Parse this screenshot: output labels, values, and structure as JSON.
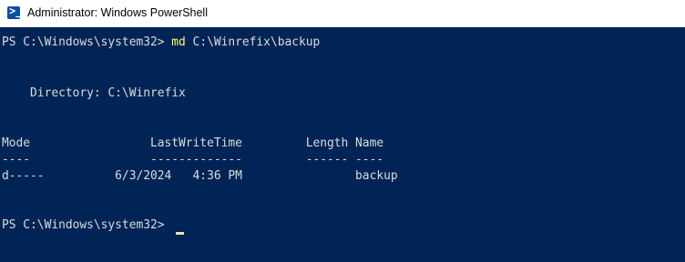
{
  "window": {
    "title": "Administrator: Windows PowerShell",
    "icon": "powershell-icon",
    "icon_glyph": ">_"
  },
  "console": {
    "prompt1": "PS C:\\Windows\\system32> ",
    "command": "md",
    "command_args": " C:\\Winrefix\\backup",
    "directory_line": "    Directory: C:\\Winrefix",
    "header_line": "Mode                 LastWriteTime         Length Name",
    "separator_line": "----                 -------------         ------ ----",
    "entry_line": "d-----          6/3/2024   4:36 PM                backup",
    "prompt2": "PS C:\\Windows\\system32> "
  },
  "colors": {
    "background": "#012456",
    "text": "#dcdcdc",
    "command": "#ffff66",
    "cursor": "#f5deb3"
  }
}
